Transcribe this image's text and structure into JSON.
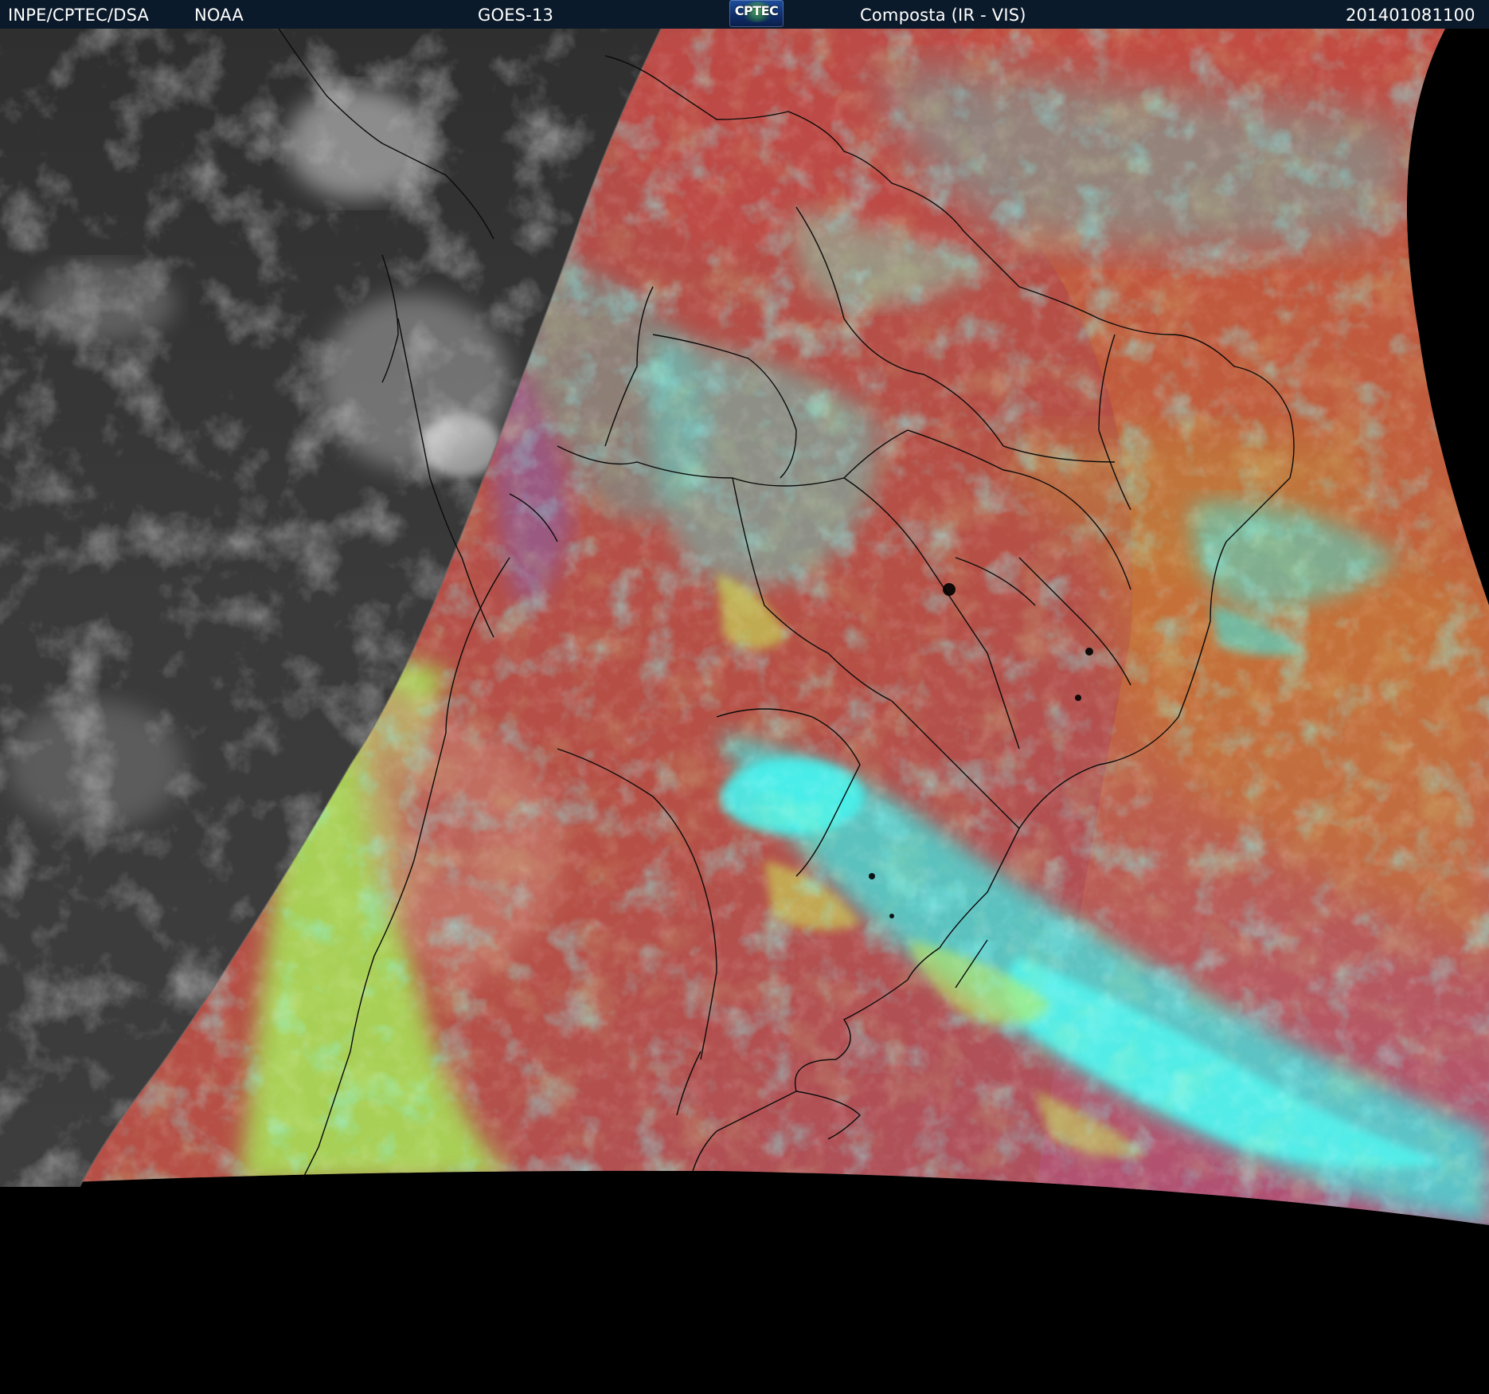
{
  "header": {
    "source_label": "INPE/CPTEC/DSA",
    "agency_label": "NOAA",
    "satellite_label": "GOES-13",
    "logo_text": "CPTEC",
    "product_label": "Composta (IR - VIS)",
    "timestamp": "201401081100"
  },
  "colors": {
    "header_bg": "#0b1a2a",
    "space_black": "#000000",
    "ir_gray": "#3a3a3a",
    "composite_red": "#b54a48",
    "cloud_cyan": "#3fe8e4",
    "cloud_green": "#a6f05a",
    "border_lines": "#000000"
  }
}
